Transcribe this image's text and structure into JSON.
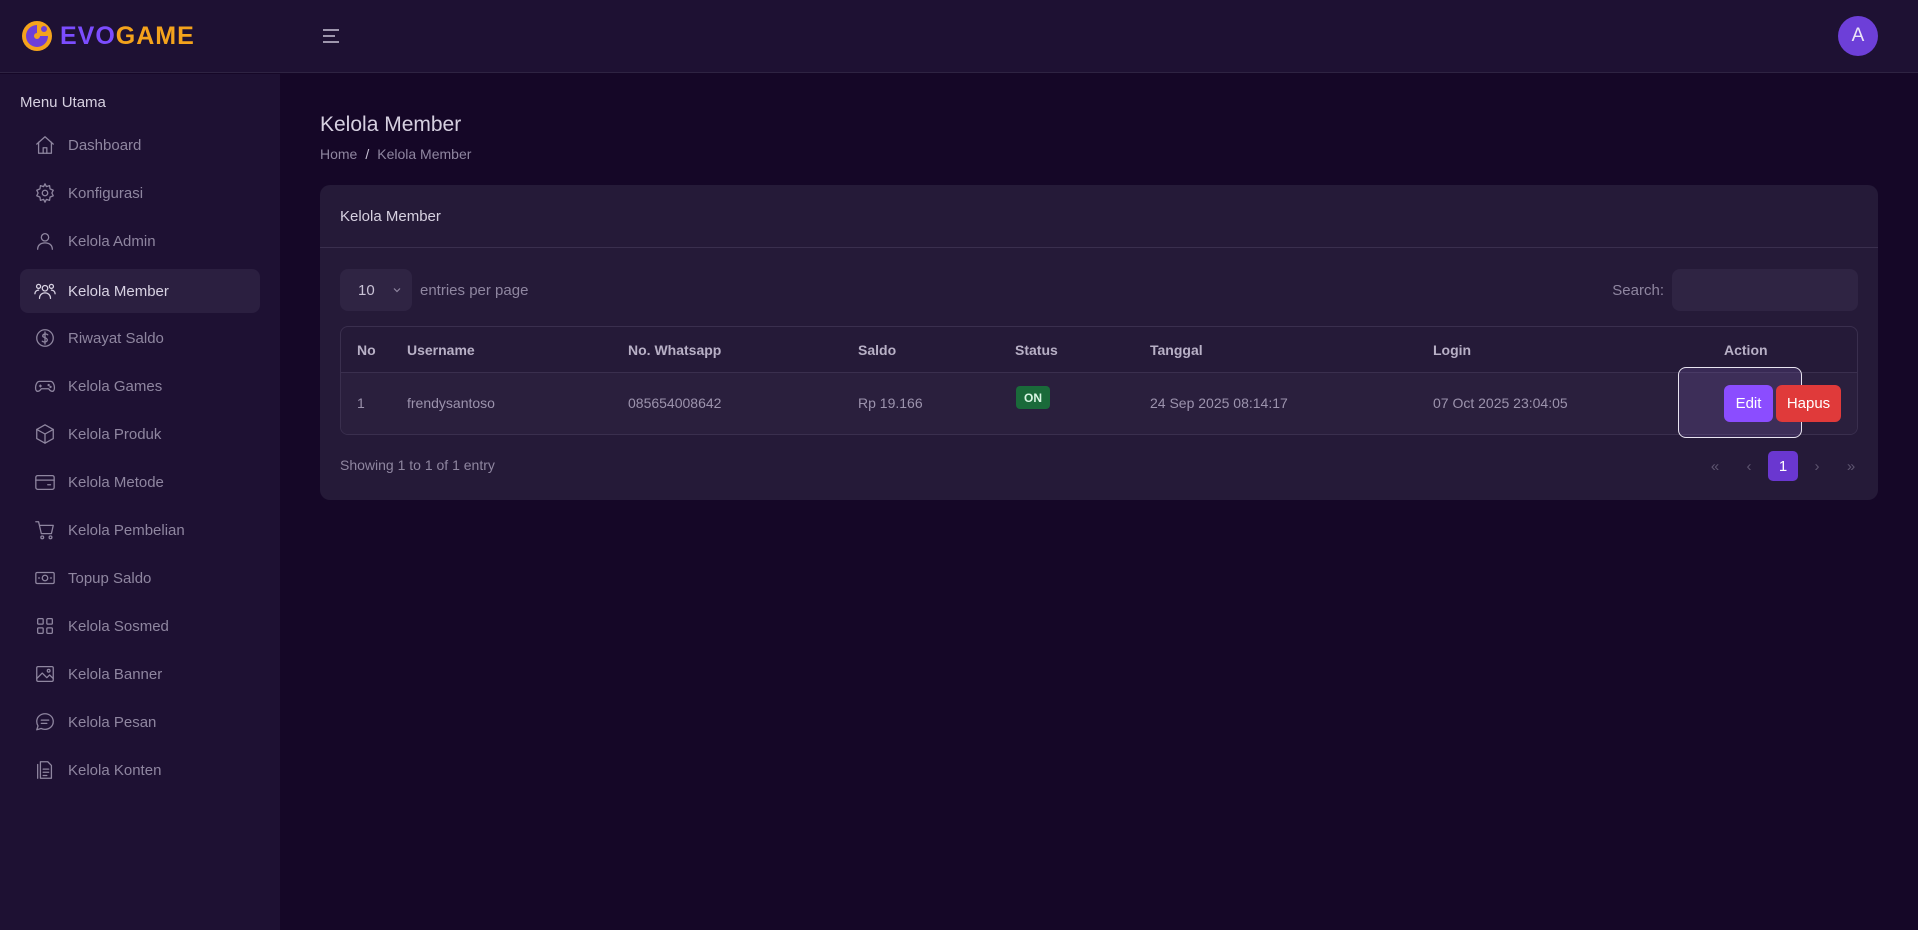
{
  "brand": {
    "part1": "EVO",
    "part2": "GAME"
  },
  "topbar": {
    "avatar_initial": "A"
  },
  "sidebar": {
    "title": "Menu Utama",
    "items": [
      {
        "label": "Dashboard",
        "icon": "home-icon"
      },
      {
        "label": "Konfigurasi",
        "icon": "gear-icon"
      },
      {
        "label": "Kelola Admin",
        "icon": "user-icon"
      },
      {
        "label": "Kelola Member",
        "icon": "users-icon",
        "active": true
      },
      {
        "label": "Riwayat Saldo",
        "icon": "dollar-circle-icon"
      },
      {
        "label": "Kelola Games",
        "icon": "gamepad-icon"
      },
      {
        "label": "Kelola Produk",
        "icon": "box-icon"
      },
      {
        "label": "Kelola Metode",
        "icon": "wallet-icon"
      },
      {
        "label": "Kelola Pembelian",
        "icon": "cart-icon"
      },
      {
        "label": "Topup Saldo",
        "icon": "money-icon"
      },
      {
        "label": "Kelola Sosmed",
        "icon": "grid-icon"
      },
      {
        "label": "Kelola Banner",
        "icon": "image-icon"
      },
      {
        "label": "Kelola Pesan",
        "icon": "chat-icon"
      },
      {
        "label": "Kelola Konten",
        "icon": "document-icon"
      }
    ]
  },
  "page": {
    "title": "Kelola Member",
    "breadcrumb": [
      "Home",
      "Kelola Member"
    ],
    "breadcrumb_sep": "/"
  },
  "card": {
    "title": "Kelola Member",
    "entries_value": "10",
    "entries_label": "entries per page",
    "search_label": "Search:",
    "search_value": "",
    "columns": [
      "No",
      "Username",
      "No. Whatsapp",
      "Saldo",
      "Status",
      "Tanggal",
      "Login",
      "Action"
    ],
    "rows": [
      {
        "no": "1",
        "username": "frendysantoso",
        "whatsapp": "085654008642",
        "saldo": "Rp 19.166",
        "status": "ON",
        "tanggal": "24 Sep 2025 08:14:17",
        "login": "07 Oct 2025 23:04:05",
        "edit_label": "Edit",
        "hapus_label": "Hapus"
      }
    ],
    "showing": "Showing 1 to 1 of 1 entry",
    "pagination": {
      "first": "«",
      "prev": "‹",
      "current": "1",
      "next": "›",
      "last": "»"
    }
  },
  "colors": {
    "background": "#150727",
    "sidebar": "#1e1133",
    "card": "#251a38",
    "accent": "#8b4dff",
    "danger": "#e03a3a",
    "status_on": "#1a6a3a",
    "brand_purple": "#7c4dff",
    "brand_orange": "#f4a31c"
  }
}
